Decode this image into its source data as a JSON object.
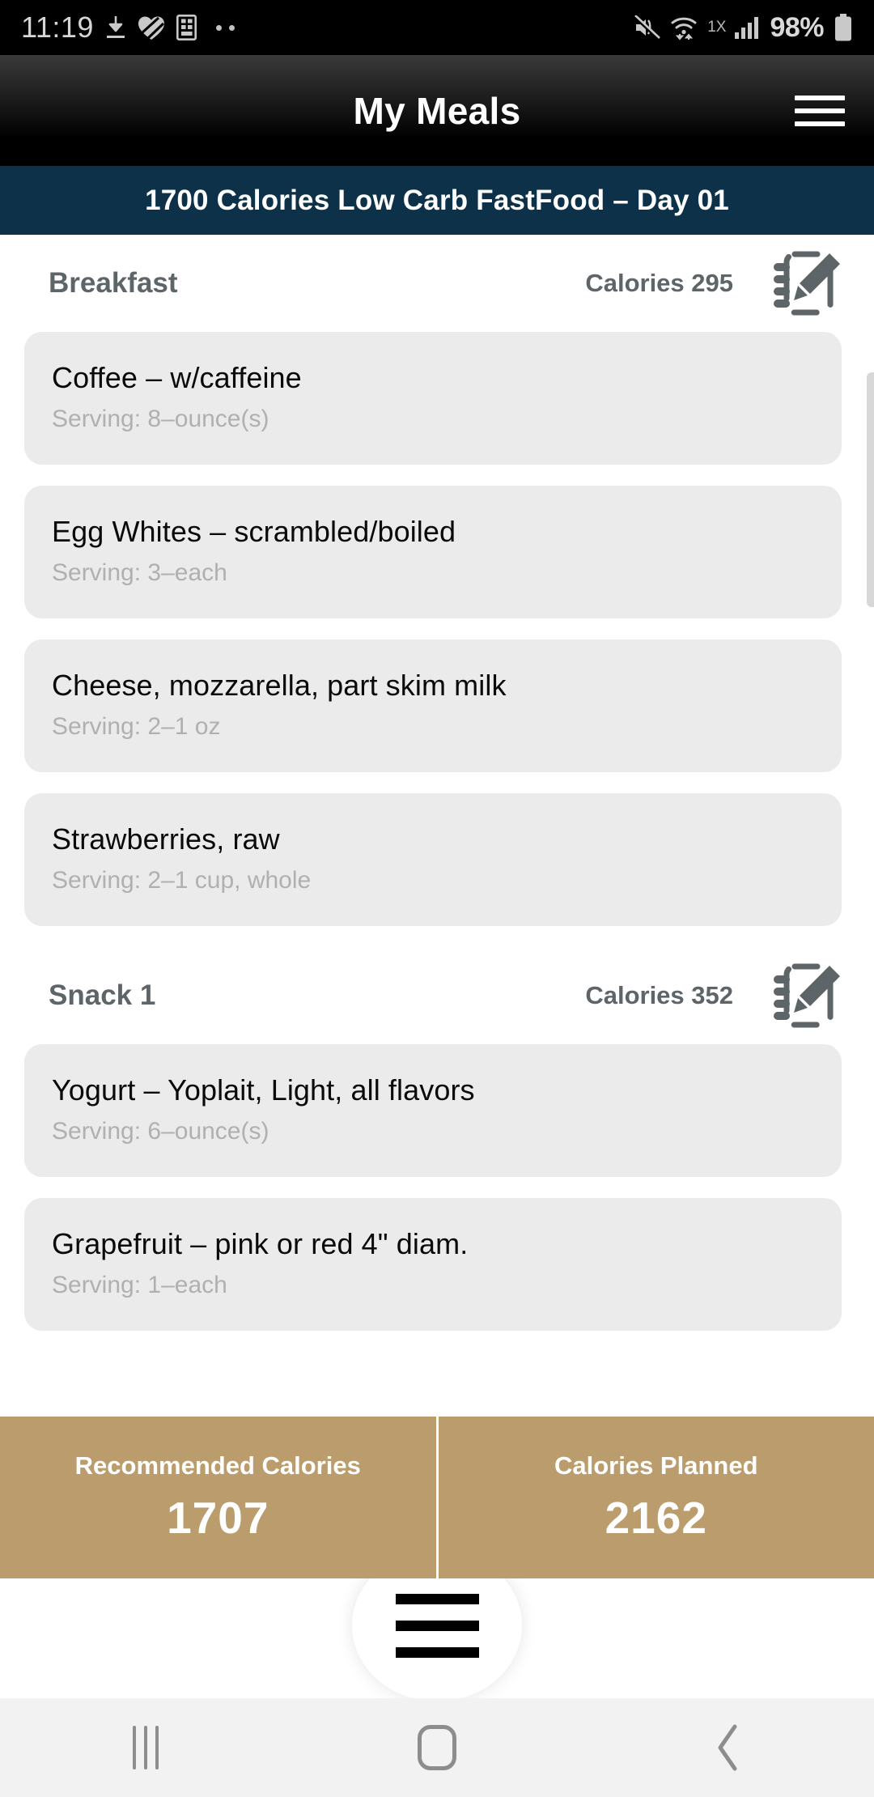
{
  "status_bar": {
    "time": "11:19",
    "left_icons": [
      "download-icon",
      "heart-icon",
      "calculator-icon",
      "more-dots-icon"
    ],
    "network_label": "1X",
    "battery_percent": "98%",
    "right_icons": [
      "mute-icon",
      "wifi-icon",
      "signal-icon",
      "battery-icon"
    ]
  },
  "app_bar": {
    "title": "My Meals",
    "menu_icon": "hamburger-menu-icon"
  },
  "subtitle_bar": {
    "text": "1700 Calories Low Carb FastFood – Day 01"
  },
  "meals": [
    {
      "name": "Breakfast",
      "calories_label": "Calories 295",
      "edit_icon": "notepad-edit-icon",
      "items": [
        {
          "title": "Coffee – w/caffeine",
          "serving": "Serving: 8–ounce(s)"
        },
        {
          "title": "Egg Whites – scrambled/boiled",
          "serving": "Serving: 3–each"
        },
        {
          "title": "Cheese, mozzarella, part skim milk",
          "serving": "Serving: 2–1 oz"
        },
        {
          "title": "Strawberries, raw",
          "serving": "Serving: 2–1 cup, whole"
        }
      ]
    },
    {
      "name": "Snack 1",
      "calories_label": "Calories 352",
      "edit_icon": "notepad-edit-icon",
      "items": [
        {
          "title": "Yogurt – Yoplait, Light, all flavors",
          "serving": "Serving: 6–ounce(s)"
        },
        {
          "title": "Grapefruit – pink or red 4\" diam.",
          "serving": "Serving: 1–each"
        }
      ]
    }
  ],
  "totals": [
    {
      "label": "Recommended Calories",
      "value": "1707"
    },
    {
      "label": "Calories Planned",
      "value": "2162"
    }
  ],
  "floating_menu": {
    "icon": "hamburger-menu-icon"
  },
  "android_nav": {
    "recents": "recents-icon",
    "home": "home-icon",
    "back": "back-icon"
  },
  "colors": {
    "app_bar": "#000000",
    "subtitle_bar": "#0d3148",
    "card": "#ebebeb",
    "totals_bar": "#bb9d6d",
    "meal_header_text": "#5e6568",
    "serving_text": "#b0b0b0"
  }
}
